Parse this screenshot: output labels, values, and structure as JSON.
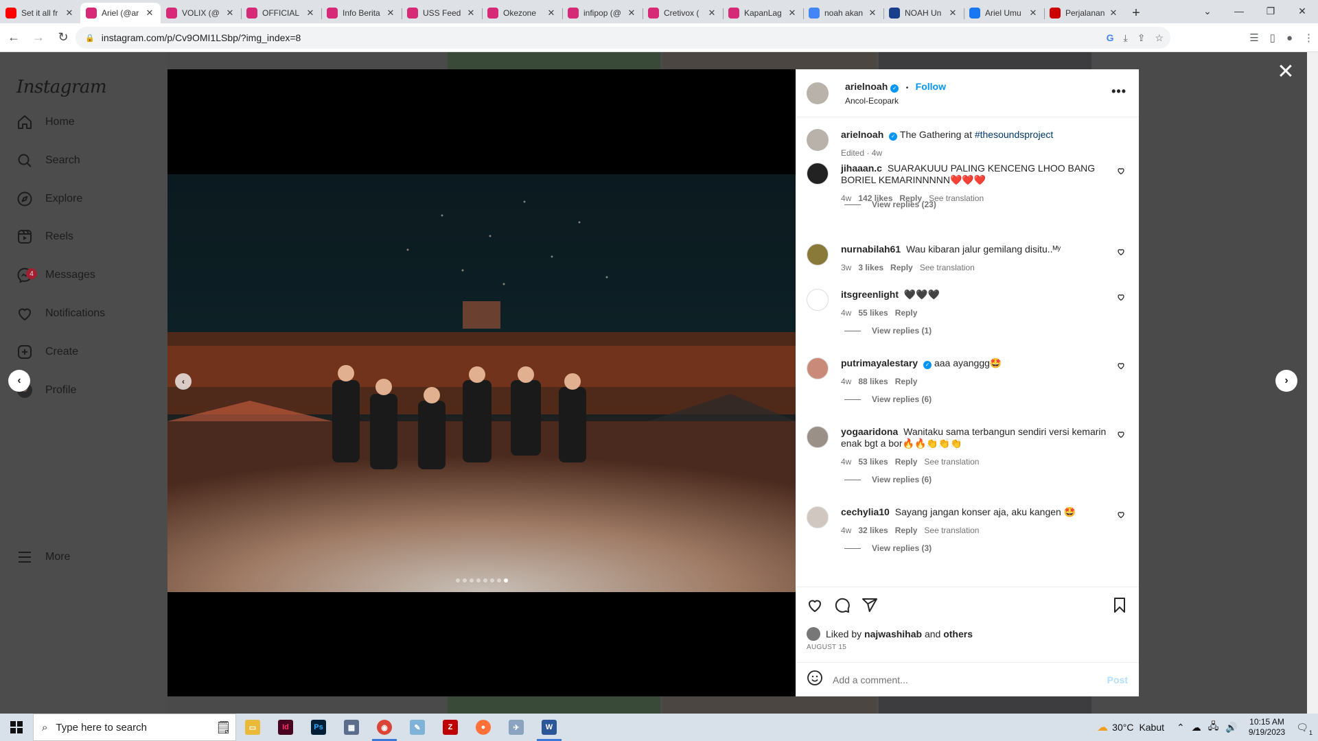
{
  "browser": {
    "tabs": [
      {
        "label": "Set it all fr",
        "icon": "youtube-icon",
        "color": "#ff0000",
        "active": false
      },
      {
        "label": "Ariel (@ar",
        "icon": "instagram-icon",
        "color": "#d62976",
        "active": true
      },
      {
        "label": "VOLIX (@",
        "icon": "instagram-icon",
        "color": "#d62976",
        "active": false
      },
      {
        "label": "OFFICIAL",
        "icon": "instagram-icon",
        "color": "#d62976",
        "active": false
      },
      {
        "label": "Info Berita",
        "icon": "instagram-icon",
        "color": "#d62976",
        "active": false
      },
      {
        "label": "USS Feed",
        "icon": "instagram-icon",
        "color": "#d62976",
        "active": false
      },
      {
        "label": "Okezone",
        "icon": "instagram-icon",
        "color": "#d62976",
        "active": false
      },
      {
        "label": "infipop (@",
        "icon": "instagram-icon",
        "color": "#d62976",
        "active": false
      },
      {
        "label": "Cretivox (",
        "icon": "instagram-icon",
        "color": "#d62976",
        "active": false
      },
      {
        "label": "KapanLag",
        "icon": "instagram-icon",
        "color": "#d62976",
        "active": false
      },
      {
        "label": "noah akan",
        "icon": "google-icon",
        "color": "#4285f4",
        "active": false
      },
      {
        "label": "NOAH Un",
        "icon": "noah-icon",
        "color": "#1a3f8a",
        "active": false
      },
      {
        "label": "Ariel Umu",
        "icon": "detik-icon",
        "color": "#1877f2",
        "active": false
      },
      {
        "label": "Perjalanan",
        "icon": "pin-icon",
        "color": "#cc0000",
        "active": false
      }
    ],
    "url": "instagram.com/p/Cv9OMI1LSbp/?img_index=8"
  },
  "sidebar": {
    "logo": "Instagram",
    "items": [
      {
        "label": "Home",
        "icon": "home-icon"
      },
      {
        "label": "Search",
        "icon": "search-icon"
      },
      {
        "label": "Explore",
        "icon": "compass-icon"
      },
      {
        "label": "Reels",
        "icon": "reels-icon"
      },
      {
        "label": "Messages",
        "icon": "messenger-icon",
        "badge": "4"
      },
      {
        "label": "Notifications",
        "icon": "heart-icon"
      },
      {
        "label": "Create",
        "icon": "plus-square-icon"
      },
      {
        "label": "Profile",
        "icon": "avatar"
      }
    ],
    "more": "More"
  },
  "post": {
    "username": "arielnoah",
    "follow": "Follow",
    "dot": "•",
    "location": "Ancol-Ecopark",
    "caption_text": "The Gathering at",
    "caption_tag": "#thesoundsproject",
    "caption_meta": "Edited · 4w",
    "carousel_total": 8,
    "carousel_index": 8,
    "liked_by_prefix": "Liked by",
    "liked_by_user": "najwashihab",
    "liked_by_and": "and",
    "liked_by_others": "others",
    "date": "AUGUST 15",
    "comment_placeholder": "Add a comment...",
    "post_button": "Post"
  },
  "comments": [
    {
      "user": "jihaaan.c",
      "verified": false,
      "text": "SUARAKUUU PALING KENCENG LHOO BANG BORIEL KEMARINNNNN❤️❤️❤️",
      "age": "4w",
      "likes": "142 likes",
      "reply": "Reply",
      "translate": "See translation",
      "replies": "View replies (23)"
    },
    {
      "user": "nurnabilah61",
      "verified": false,
      "text": "Wau kibaran jalur gemilang disitu..ᴹʸ",
      "age": "3w",
      "likes": "3 likes",
      "reply": "Reply",
      "translate": "See translation",
      "replies": ""
    },
    {
      "user": "itsgreenlight",
      "verified": false,
      "text": "🖤🖤🖤",
      "age": "4w",
      "likes": "55 likes",
      "reply": "Reply",
      "translate": "",
      "replies": "View replies (1)"
    },
    {
      "user": "putrimayalestary",
      "verified": true,
      "text": "aaa ayanggg🤩",
      "age": "4w",
      "likes": "88 likes",
      "reply": "Reply",
      "translate": "",
      "replies": "View replies (6)"
    },
    {
      "user": "yogaaridona",
      "verified": false,
      "text": "Wanitaku sama terbangun sendiri versi kemarin enak bgt a bor🔥🔥👏👏👏",
      "age": "4w",
      "likes": "53 likes",
      "reply": "Reply",
      "translate": "See translation",
      "replies": "View replies (6)"
    },
    {
      "user": "cechylia10",
      "verified": false,
      "text": "Sayang jangan konser aja, aku kangen 🤩",
      "age": "4w",
      "likes": "32 likes",
      "reply": "Reply",
      "translate": "See translation",
      "replies": "View replies (3)"
    }
  ],
  "taskbar": {
    "search_placeholder": "Type here to search",
    "weather_temp": "30°C",
    "weather_text": "Kabut",
    "time": "10:15 AM",
    "date": "9/19/2023",
    "notif_count": "1"
  },
  "colors": {
    "accent": "#0095f6",
    "overlay": "#4a4a4a",
    "badge": "#ff3040"
  }
}
